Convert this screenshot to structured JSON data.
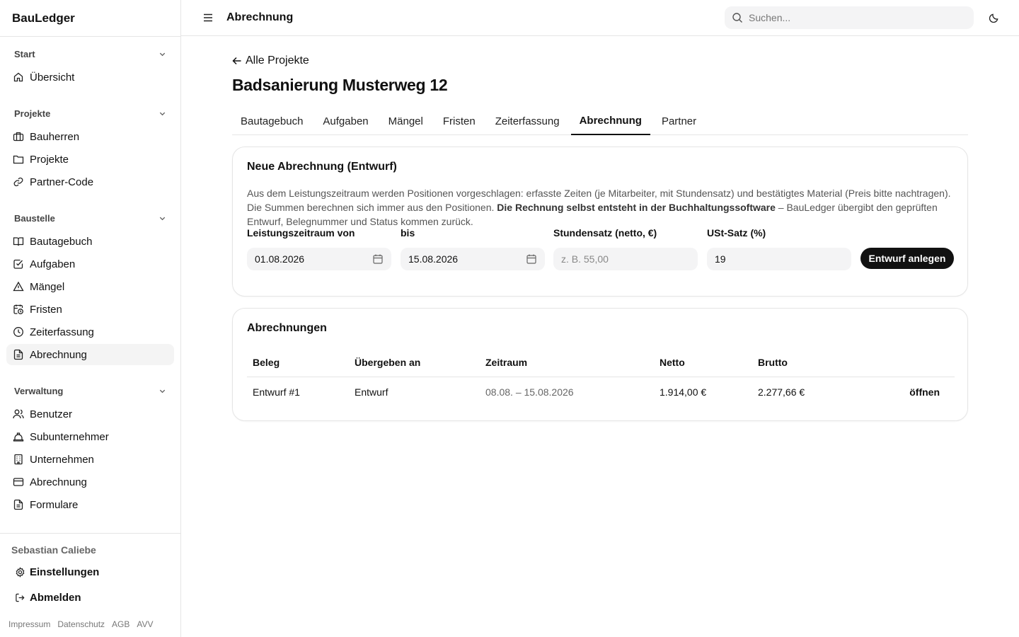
{
  "app": {
    "name": "BauLedger"
  },
  "sidebar": {
    "groups": [
      {
        "title": "Start",
        "items": [
          {
            "label": "Übersicht",
            "icon": "home-icon"
          }
        ]
      },
      {
        "title": "Projekte",
        "items": [
          {
            "label": "Bauherren",
            "icon": "briefcase-icon"
          },
          {
            "label": "Projekte",
            "icon": "folder-icon"
          },
          {
            "label": "Partner-Code",
            "icon": "link-icon"
          }
        ]
      },
      {
        "title": "Baustelle",
        "items": [
          {
            "label": "Bautagebuch",
            "icon": "book-icon"
          },
          {
            "label": "Aufgaben",
            "icon": "checkbox-icon"
          },
          {
            "label": "Mängel",
            "icon": "warning-icon"
          },
          {
            "label": "Fristen",
            "icon": "calendar-clock-icon"
          },
          {
            "label": "Zeiterfassung",
            "icon": "clock-icon"
          },
          {
            "label": "Abrechnung",
            "icon": "document-icon",
            "active": true
          }
        ]
      },
      {
        "title": "Verwaltung",
        "items": [
          {
            "label": "Benutzer",
            "icon": "users-icon"
          },
          {
            "label": "Subunternehmer",
            "icon": "hardhat-icon"
          },
          {
            "label": "Unternehmen",
            "icon": "building-icon"
          },
          {
            "label": "Abrechnung",
            "icon": "credit-card-icon"
          },
          {
            "label": "Formulare",
            "icon": "form-icon"
          }
        ]
      }
    ],
    "user": "Sebastian Caliebe",
    "settings_label": "Einstellungen",
    "logout_label": "Abmelden",
    "legal": [
      "Impressum",
      "Datenschutz",
      "AGB",
      "AVV"
    ]
  },
  "topbar": {
    "title": "Abrechnung",
    "search_placeholder": "Suchen..."
  },
  "page": {
    "back_label": "Alle Projekte",
    "title": "Badsanierung Musterweg 12",
    "tabs": [
      "Bautagebuch",
      "Aufgaben",
      "Mängel",
      "Fristen",
      "Zeiterfassung",
      "Abrechnung",
      "Partner"
    ],
    "active_tab": "Abrechnung"
  },
  "draft_card": {
    "title": "Neue Abrechnung (Entwurf)",
    "desc_part1": "Aus dem Leistungszeitraum werden Positionen vorgeschlagen: erfasste Zeiten (je Mitarbeiter, mit Stundensatz) und bestätigtes Material (Preis bitte nachtragen). Die Summen berechnen sich immer aus den Positionen. ",
    "desc_bold": "Die Rechnung selbst entsteht in der Buchhaltungssoftware",
    "desc_part2": " – BauLedger übergibt den geprüften Entwurf, Belegnummer und Status kommen zurück.",
    "from_label": "Leistungszeitraum von",
    "from_value": "01.08.2026",
    "to_label": "bis",
    "to_value": "15.08.2026",
    "rate_label": "Stundensatz (netto, €)",
    "rate_placeholder": "z. B. 55,00",
    "vat_label": "USt-Satz (%)",
    "vat_value": "19",
    "submit_label": "Entwurf anlegen"
  },
  "list_card": {
    "title": "Abrechnungen",
    "columns": [
      "Beleg",
      "Übergeben an",
      "Zeitraum",
      "Netto",
      "Brutto",
      ""
    ],
    "rows": [
      {
        "beleg": "Entwurf #1",
        "uebergeben": "Entwurf",
        "zeitraum": "08.08. – 15.08.2026",
        "netto": "1.914,00 €",
        "brutto": "2.277,66 €",
        "action": "öffnen"
      }
    ]
  }
}
